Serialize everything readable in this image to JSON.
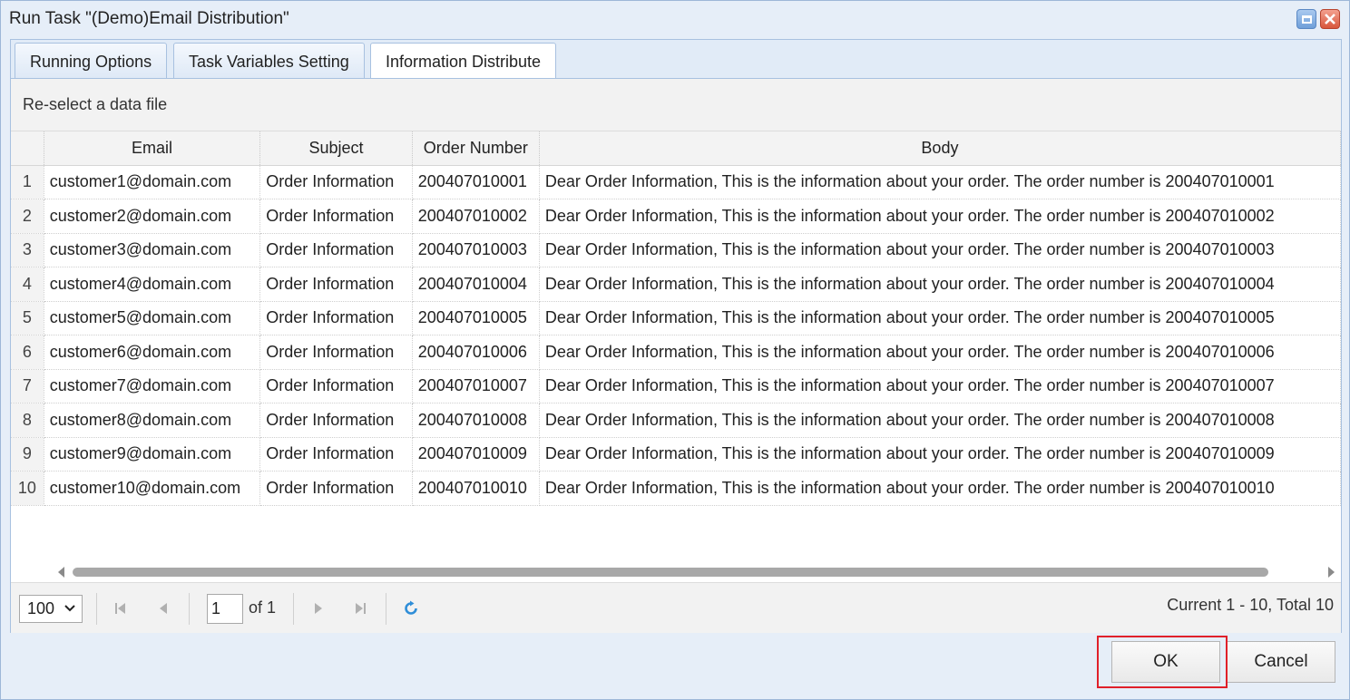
{
  "window": {
    "title": "Run Task \"(Demo)Email Distribution\""
  },
  "tabs": [
    {
      "label": "Running Options"
    },
    {
      "label": "Task Variables Setting"
    },
    {
      "label": "Information Distribute"
    }
  ],
  "toolbar": {
    "reselect_label": "Re-select a data file"
  },
  "grid": {
    "columns": [
      "Email",
      "Subject",
      "Order Number",
      "Body"
    ],
    "rows": [
      {
        "n": "1",
        "email": "customer1@domain.com",
        "subject": "Order Information",
        "order": "200407010001",
        "body": "Dear Order Information, This is the information about your order. The order number is 200407010001"
      },
      {
        "n": "2",
        "email": "customer2@domain.com",
        "subject": "Order Information",
        "order": "200407010002",
        "body": "Dear Order Information, This is the information about your order. The order number is 200407010002"
      },
      {
        "n": "3",
        "email": "customer3@domain.com",
        "subject": "Order Information",
        "order": "200407010003",
        "body": "Dear Order Information, This is the information about your order. The order number is 200407010003"
      },
      {
        "n": "4",
        "email": "customer4@domain.com",
        "subject": "Order Information",
        "order": "200407010004",
        "body": "Dear Order Information, This is the information about your order. The order number is 200407010004"
      },
      {
        "n": "5",
        "email": "customer5@domain.com",
        "subject": "Order Information",
        "order": "200407010005",
        "body": "Dear Order Information, This is the information about your order. The order number is 200407010005"
      },
      {
        "n": "6",
        "email": "customer6@domain.com",
        "subject": "Order Information",
        "order": "200407010006",
        "body": "Dear Order Information, This is the information about your order. The order number is 200407010006"
      },
      {
        "n": "7",
        "email": "customer7@domain.com",
        "subject": "Order Information",
        "order": "200407010007",
        "body": "Dear Order Information, This is the information about your order. The order number is 200407010007"
      },
      {
        "n": "8",
        "email": "customer8@domain.com",
        "subject": "Order Information",
        "order": "200407010008",
        "body": "Dear Order Information, This is the information about your order. The order number is 200407010008"
      },
      {
        "n": "9",
        "email": "customer9@domain.com",
        "subject": "Order Information",
        "order": "200407010009",
        "body": "Dear Order Information, This is the information about your order. The order number is 200407010009"
      },
      {
        "n": "10",
        "email": "customer10@domain.com",
        "subject": "Order Information",
        "order": "200407010010",
        "body": "Dear Order Information, This is the information about your order. The order number is 200407010010"
      }
    ]
  },
  "pager": {
    "page_size": "100",
    "current_page": "1",
    "of_label": "of 1",
    "summary": "Current 1 - 10, Total 10"
  },
  "buttons": {
    "ok_label": "OK",
    "cancel_label": "Cancel"
  },
  "colors": {
    "highlight": "#e0202a",
    "refresh": "#2f8ed8"
  }
}
